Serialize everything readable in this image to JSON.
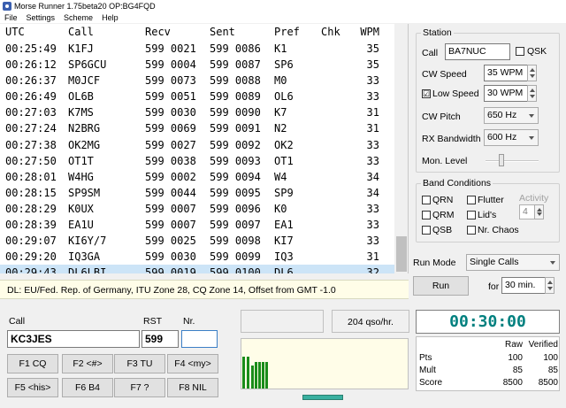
{
  "window": {
    "title": "Morse Runner 1.75beta20   OP:BG4FQD"
  },
  "menu": [
    "File",
    "Settings",
    "Scheme",
    "Help"
  ],
  "log": {
    "headers": {
      "utc": "UTC",
      "call": "Call",
      "recv": "Recv",
      "sent": "Sent",
      "pref": "Pref",
      "chk": "Chk",
      "wpm": "WPM"
    },
    "rows": [
      {
        "utc": "00:25:49",
        "call": "K1FJ",
        "recv": "599 0021",
        "sent": "599 0086",
        "pref": "K1",
        "chk": "",
        "wpm": "35"
      },
      {
        "utc": "00:26:12",
        "call": "SP6GCU",
        "recv": "599 0004",
        "sent": "599 0087",
        "pref": "SP6",
        "chk": "",
        "wpm": "35"
      },
      {
        "utc": "00:26:37",
        "call": "M0JCF",
        "recv": "599 0073",
        "sent": "599 0088",
        "pref": "M0",
        "chk": "",
        "wpm": "33"
      },
      {
        "utc": "00:26:49",
        "call": "OL6B",
        "recv": "599 0051",
        "sent": "599 0089",
        "pref": "OL6",
        "chk": "",
        "wpm": "33"
      },
      {
        "utc": "00:27:03",
        "call": "K7MS",
        "recv": "599 0030",
        "sent": "599 0090",
        "pref": "K7",
        "chk": "",
        "wpm": "31"
      },
      {
        "utc": "00:27:24",
        "call": "N2BRG",
        "recv": "599 0069",
        "sent": "599 0091",
        "pref": "N2",
        "chk": "",
        "wpm": "31"
      },
      {
        "utc": "00:27:38",
        "call": "OK2MG",
        "recv": "599 0027",
        "sent": "599 0092",
        "pref": "OK2",
        "chk": "",
        "wpm": "33"
      },
      {
        "utc": "00:27:50",
        "call": "OT1T",
        "recv": "599 0038",
        "sent": "599 0093",
        "pref": "OT1",
        "chk": "",
        "wpm": "33"
      },
      {
        "utc": "00:28:01",
        "call": "W4HG",
        "recv": "599 0002",
        "sent": "599 0094",
        "pref": "W4",
        "chk": "",
        "wpm": "34"
      },
      {
        "utc": "00:28:15",
        "call": "SP9SM",
        "recv": "599 0044",
        "sent": "599 0095",
        "pref": "SP9",
        "chk": "",
        "wpm": "34"
      },
      {
        "utc": "00:28:29",
        "call": "K0UX",
        "recv": "599 0007",
        "sent": "599 0096",
        "pref": "K0",
        "chk": "",
        "wpm": "33"
      },
      {
        "utc": "00:28:39",
        "call": "EA1U",
        "recv": "599 0007",
        "sent": "599 0097",
        "pref": "EA1",
        "chk": "",
        "wpm": "33"
      },
      {
        "utc": "00:29:07",
        "call": "KI6Y/7",
        "recv": "599 0025",
        "sent": "599 0098",
        "pref": "KI7",
        "chk": "",
        "wpm": "33"
      },
      {
        "utc": "00:29:20",
        "call": "IQ3GA",
        "recv": "599 0030",
        "sent": "599 0099",
        "pref": "IQ3",
        "chk": "",
        "wpm": "31"
      },
      {
        "utc": "00:29:43",
        "call": "DL6LBI",
        "recv": "599 0019",
        "sent": "599 0100",
        "pref": "DL6",
        "chk": "",
        "wpm": "32"
      }
    ]
  },
  "status_line": "DL:  EU/Fed. Rep. of Germany, ITU Zone 28,  CQ Zone 14,  Offset from GMT -1.0",
  "station": {
    "group_label": "Station",
    "call_label": "Call",
    "call_value": "BA7NUC",
    "qsk_label": "QSK",
    "cw_speed_label": "CW Speed",
    "cw_speed_value": "35 WPM",
    "low_speed_label": "Low Speed",
    "low_speed_checked": "☑",
    "low_speed_value": "30 WPM",
    "cw_pitch_label": "CW Pitch",
    "cw_pitch_value": "650 Hz",
    "rx_bw_label": "RX Bandwidth",
    "rx_bw_value": "600 Hz",
    "mon_level_label": "Mon. Level"
  },
  "band_conditions": {
    "group_label": "Band Conditions",
    "qrn": "QRN",
    "qrm": "QRM",
    "qsb": "QSB",
    "flutter": "Flutter",
    "lids": "Lid's",
    "nr_chaos": "Nr. Chaos",
    "activity_label": "Activity",
    "activity_value": "4"
  },
  "run": {
    "mode_label": "Run Mode",
    "mode_value": "Single Calls",
    "run_button": "Run",
    "for_label": "for",
    "duration_value": "30 min."
  },
  "entry": {
    "call_label": "Call",
    "call_value": "KC3JES",
    "rst_label": "RST",
    "rst_value": "599",
    "nr_label": "Nr.",
    "nr_value": ""
  },
  "function_keys": [
    [
      "F1  CQ",
      "F2  <#>",
      "F3  TU",
      "F4  <my>"
    ],
    [
      "F5  <his>",
      "F6  B4",
      "F7  ?",
      "F8  NIL"
    ]
  ],
  "rate": {
    "value": "204  qso/hr."
  },
  "clock": "00:30:00",
  "score": {
    "col_raw": "Raw",
    "col_verified": "Verified",
    "rows": [
      {
        "label": "Pts",
        "raw": "100",
        "verified": "100"
      },
      {
        "label": "Mult",
        "raw": "85",
        "verified": "85"
      },
      {
        "label": "Score",
        "raw": "8500",
        "verified": "8500"
      }
    ]
  },
  "colors": {
    "clock_text": "#00807f",
    "selected_row": "#cce4f7",
    "meter_bar": "#1a8c1a"
  }
}
